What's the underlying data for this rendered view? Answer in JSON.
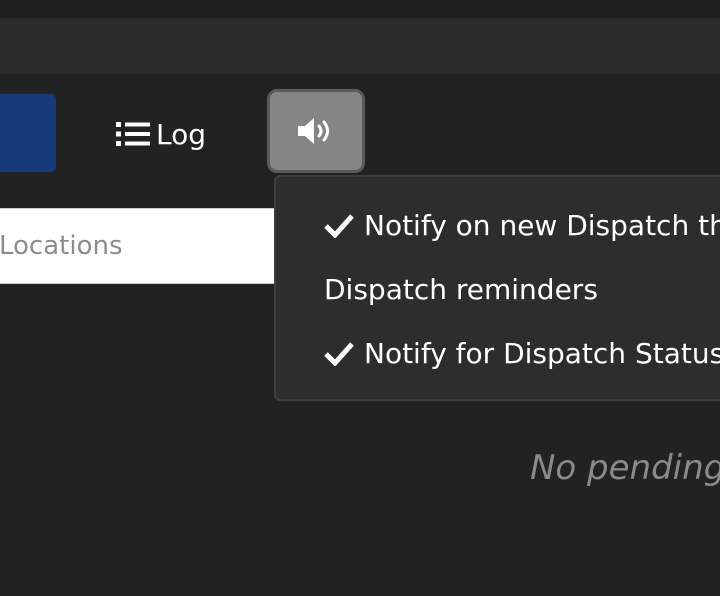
{
  "toolbar": {
    "log_label": "Log",
    "log_icon": "list-icon",
    "sound_icon": "volume-up-icon"
  },
  "search": {
    "placeholder": "Locations",
    "value": ""
  },
  "notifications_menu": {
    "items": [
      {
        "label": "Notify on new Dispatch th",
        "checked": true
      },
      {
        "label": "Dispatch reminders",
        "checked": false
      },
      {
        "label": "Notify for Dispatch Status",
        "checked": true
      }
    ]
  },
  "main": {
    "empty_message": "No pending"
  },
  "colors": {
    "background": "#222222",
    "navbar": "#2b2b2b",
    "primary_button": "#163a7a",
    "sound_button": "#858585",
    "menu_background": "#2d2d2d",
    "muted_text": "#8a8a8a"
  }
}
